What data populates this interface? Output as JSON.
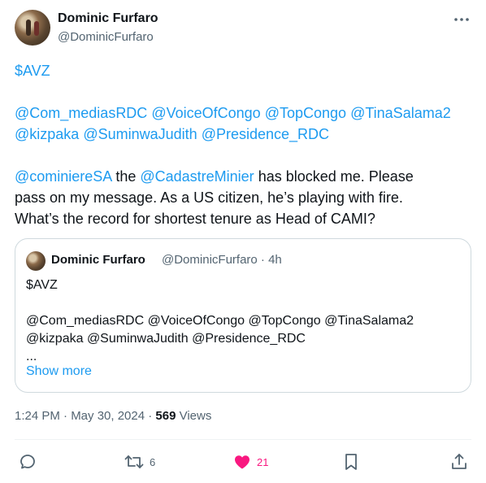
{
  "author": {
    "name": "Dominic Furfaro",
    "handle": "@DominicFurfaro"
  },
  "tweet": {
    "line1": "$AVZ",
    "mentions_line1": [
      "@Com_mediasRDC",
      "@VoiceOfCongo",
      "@TopCongo",
      "@TinaSalama2"
    ],
    "mentions_line2": [
      "@kizpaka",
      "@SuminwaJudith",
      "@Presidence_RDC"
    ],
    "p3_mention1": "@cominiereSA",
    "p3_word": " the ",
    "p3_mention2": "@CadastreMinier",
    "p3_rest1": " has blocked me. Please",
    "p3_line2": "pass on my message. As a US citizen, he’s playing with fire.",
    "p3_line3": "What’s the record for shortest tenure as Head of CAMI?"
  },
  "quote": {
    "name": "Dominic Furfaro",
    "meta": "@DominicFurfaro · 4h",
    "line1": "$AVZ",
    "line2": "@Com_mediasRDC @VoiceOfCongo @TopCongo @TinaSalama2",
    "line3": "@kizpaka @SuminwaJudith @Presidence_RDC",
    "line4": "...",
    "show_more": "Show more"
  },
  "meta": {
    "time": "1:24 PM · May 30, 2024 · ",
    "views_count": "569",
    "views_label": " Views"
  },
  "actions": {
    "retweets": "6",
    "likes": "21"
  },
  "colors": {
    "link": "#1d9bf0",
    "like": "#f91880",
    "secondary": "#536471"
  }
}
